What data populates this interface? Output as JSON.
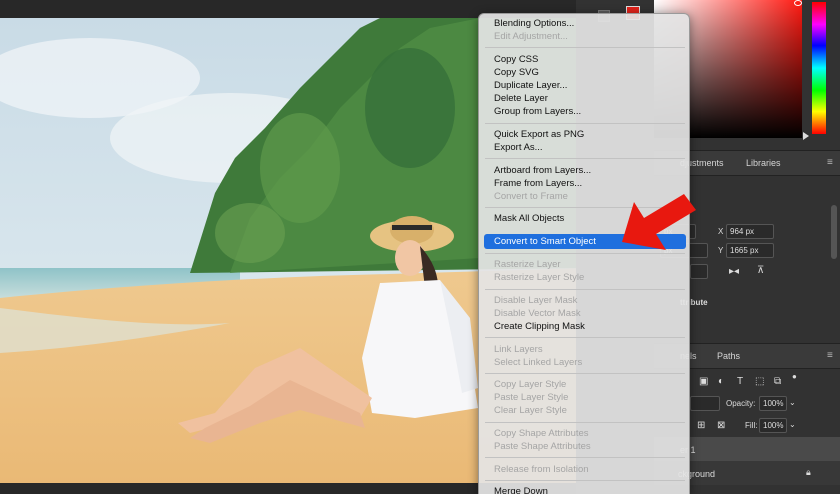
{
  "context_menu": {
    "items": [
      {
        "label": "Blending Options...",
        "enabled": true
      },
      {
        "label": "Edit Adjustment...",
        "enabled": false
      },
      {
        "label": "Copy CSS",
        "enabled": true
      },
      {
        "label": "Copy SVG",
        "enabled": true
      },
      {
        "label": "Duplicate Layer...",
        "enabled": true
      },
      {
        "label": "Delete Layer",
        "enabled": true
      },
      {
        "label": "Group from Layers...",
        "enabled": true
      },
      {
        "label": "Quick Export as PNG",
        "enabled": true
      },
      {
        "label": "Export As...",
        "enabled": true
      },
      {
        "label": "Artboard from Layers...",
        "enabled": true
      },
      {
        "label": "Frame from Layers...",
        "enabled": true
      },
      {
        "label": "Convert to Frame",
        "enabled": false
      },
      {
        "label": "Mask All Objects",
        "enabled": true
      },
      {
        "label": "Convert to Smart Object",
        "enabled": true,
        "selected": true
      },
      {
        "label": "Rasterize Layer",
        "enabled": false
      },
      {
        "label": "Rasterize Layer Style",
        "enabled": false
      },
      {
        "label": "Disable Layer Mask",
        "enabled": false
      },
      {
        "label": "Disable Vector Mask",
        "enabled": false
      },
      {
        "label": "Create Clipping Mask",
        "enabled": true
      },
      {
        "label": "Link Layers",
        "enabled": false
      },
      {
        "label": "Select Linked Layers",
        "enabled": false
      },
      {
        "label": "Copy Layer Style",
        "enabled": false
      },
      {
        "label": "Paste Layer Style",
        "enabled": false
      },
      {
        "label": "Clear Layer Style",
        "enabled": false
      },
      {
        "label": "Copy Shape Attributes",
        "enabled": false
      },
      {
        "label": "Paste Shape Attributes",
        "enabled": false
      },
      {
        "label": "Release from Isolation",
        "enabled": false
      },
      {
        "label": "Merge Down",
        "enabled": true
      }
    ]
  },
  "panels": {
    "tab_adjustments": "djustments",
    "tab_libraries": "Libraries",
    "menu_glyph": "≡",
    "properties": {
      "w_value": "px",
      "h_value": "px",
      "x_label": "X",
      "x_value": "964 px",
      "y_label": "Y",
      "y_value": "1665 px",
      "section_label": "ttribute"
    },
    "tab_channels": "nels",
    "tab_paths": "Paths",
    "opacity_label": "Opacity:",
    "opacity_value": "100%",
    "fill_label": "Fill:",
    "fill_value": "100%",
    "layer1_name": "er 1",
    "layer2_name": "ckground"
  },
  "colors": {
    "foreground": "#e0221a",
    "highlight": "#1f6fde",
    "arrow": "#e8180f"
  }
}
